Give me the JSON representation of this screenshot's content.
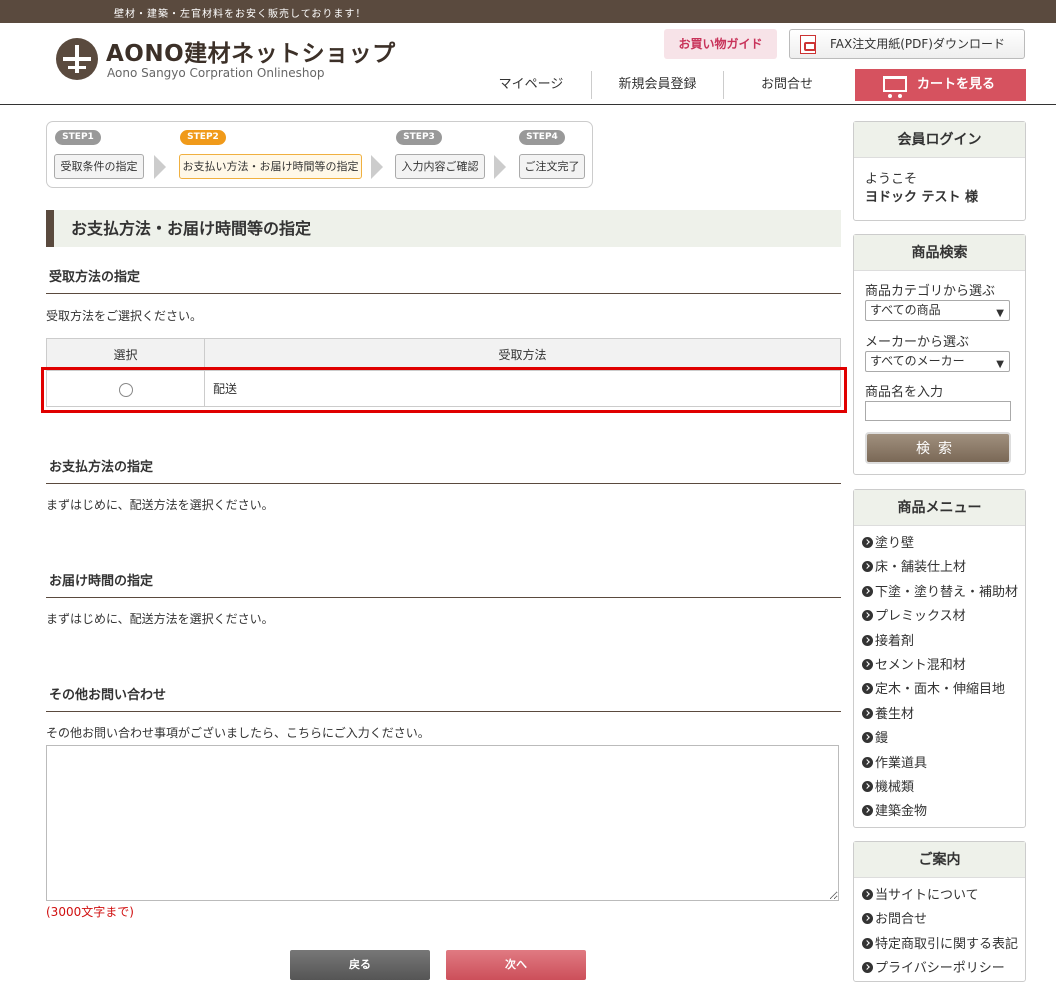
{
  "topbar": {
    "text": "壁材・建築・左官材料をお安く販売しております！"
  },
  "header": {
    "logo_title": "AONO建材ネットショップ",
    "logo_sub": "Aono Sangyo  Corpration  Onlineshop",
    "guide_label": "お買い物ガイド",
    "fax_label": "FAX注文用紙(PDF)ダウンロード",
    "nav": [
      "マイページ",
      "新規会員登録",
      "お問合せ"
    ],
    "cart_label": "カートを見る"
  },
  "steps": [
    {
      "badge": "STEP1",
      "label": "受取条件の指定",
      "active": false
    },
    {
      "badge": "STEP2",
      "label": "お支払い方法・お届け時間等の指定",
      "active": true
    },
    {
      "badge": "STEP3",
      "label": "入力内容ご確認",
      "active": false
    },
    {
      "badge": "STEP4",
      "label": "ご注文完了",
      "active": false
    }
  ],
  "page_title": "お支払方法・お届け時間等の指定",
  "receive": {
    "title": "受取方法の指定",
    "instruction": "受取方法をご選択ください。",
    "col_select": "選択",
    "col_method": "受取方法",
    "rows": [
      {
        "method": "配送",
        "selected": false
      }
    ]
  },
  "payment": {
    "title": "お支払方法の指定",
    "text": "まずはじめに、配送方法を選択ください。"
  },
  "delivery_time": {
    "title": "お届け時間の指定",
    "text": "まずはじめに、配送方法を選択ください。"
  },
  "inquiry": {
    "title": "その他お問い合わせ",
    "text": "その他お問い合わせ事項がございましたら、こちらにご入力ください。",
    "value": "",
    "limit": "(3000文字まで)"
  },
  "buttons": {
    "back": "戻る",
    "next": "次へ"
  },
  "sidebar": {
    "login": {
      "title": "会員ログイン",
      "welcome": "ようこそ",
      "user": "ヨドック テスト 様"
    },
    "search": {
      "title": "商品検索",
      "category_label": "商品カテゴリから選ぶ",
      "category_value": "すべての商品",
      "maker_label": "メーカーから選ぶ",
      "maker_value": "すべてのメーカー",
      "name_label": "商品名を入力",
      "name_value": "",
      "button": "検索"
    },
    "menu": {
      "title": "商品メニュー",
      "items": [
        "塗り壁",
        "床・舗装仕上材",
        "下塗・塗り替え・補助材",
        "プレミックス材",
        "接着剤",
        "セメント混和材",
        "定木・面木・伸縮目地",
        "養生材",
        "鏝",
        "作業道具",
        "機械類",
        "建築金物"
      ]
    },
    "info": {
      "title": "ご案内",
      "items": [
        "当サイトについて",
        "お問合せ",
        "特定商取引に関する表記",
        "プライバシーポリシー"
      ]
    }
  },
  "colors": {
    "brand": "#5a4a3e",
    "cart": "#d6525f",
    "step_active": "#f09a1a",
    "highlight": "#e00000"
  }
}
